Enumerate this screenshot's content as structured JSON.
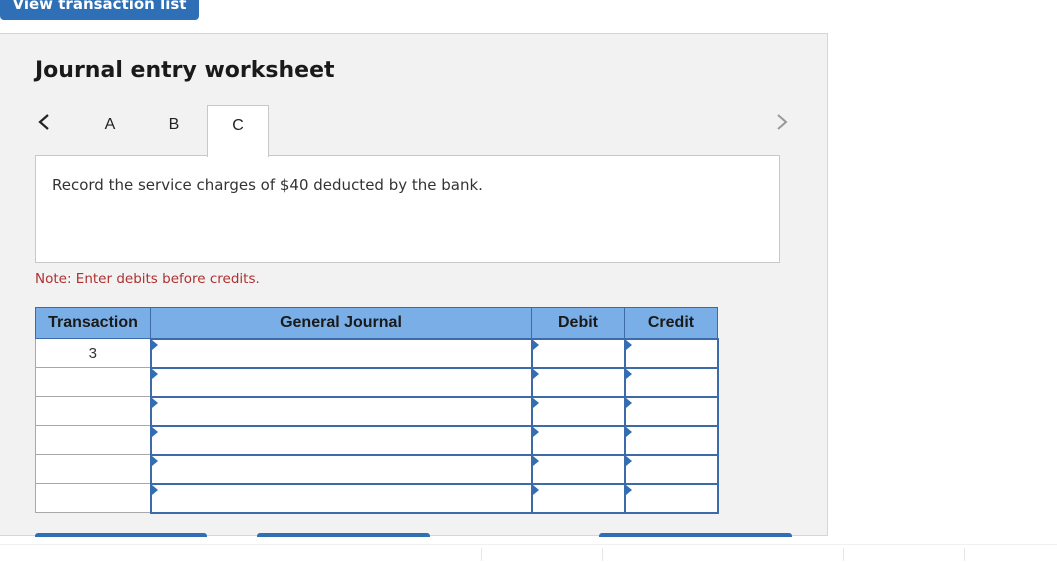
{
  "top_button": {
    "label": "View transaction list"
  },
  "worksheet": {
    "title": "Journal entry worksheet",
    "nav": {
      "prev_icon": "chevron-left-icon",
      "next_icon": "chevron-right-icon"
    },
    "tabs": [
      {
        "label": "A",
        "active": false
      },
      {
        "label": "B",
        "active": false
      },
      {
        "label": "C",
        "active": true
      }
    ],
    "description": "Record the service charges of $40 deducted by the bank.",
    "note": "Note: Enter debits before credits.",
    "table": {
      "headers": [
        "Transaction",
        "General Journal",
        "Debit",
        "Credit"
      ],
      "rows": [
        {
          "transaction": "3",
          "account": "",
          "debit": "",
          "credit": ""
        },
        {
          "transaction": "",
          "account": "",
          "debit": "",
          "credit": ""
        },
        {
          "transaction": "",
          "account": "",
          "debit": "",
          "credit": ""
        },
        {
          "transaction": "",
          "account": "",
          "debit": "",
          "credit": ""
        },
        {
          "transaction": "",
          "account": "",
          "debit": "",
          "credit": ""
        },
        {
          "transaction": "",
          "account": "",
          "debit": "",
          "credit": ""
        }
      ]
    }
  },
  "colors": {
    "accent": "#2f6fb5",
    "header_bg": "#7aaee6",
    "note_text": "#b03030",
    "panel_bg": "#f2f2f2"
  }
}
